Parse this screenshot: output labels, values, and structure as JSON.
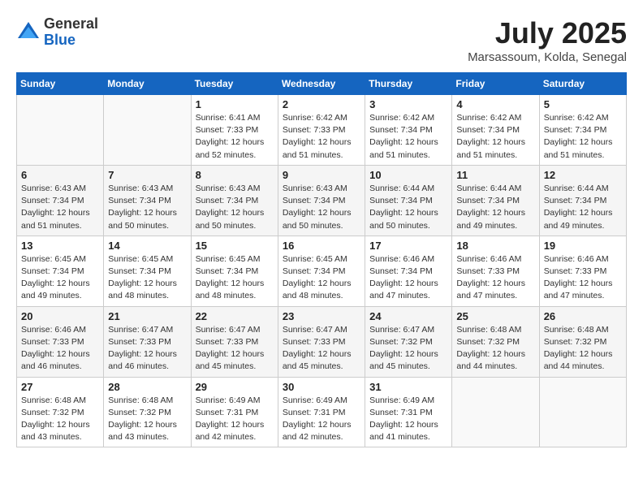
{
  "logo": {
    "general": "General",
    "blue": "Blue"
  },
  "title": {
    "month_year": "July 2025",
    "location": "Marsassoum, Kolda, Senegal"
  },
  "weekdays": [
    "Sunday",
    "Monday",
    "Tuesday",
    "Wednesday",
    "Thursday",
    "Friday",
    "Saturday"
  ],
  "weeks": [
    [
      {
        "num": "",
        "info": ""
      },
      {
        "num": "",
        "info": ""
      },
      {
        "num": "1",
        "info": "Sunrise: 6:41 AM\nSunset: 7:33 PM\nDaylight: 12 hours\nand 52 minutes."
      },
      {
        "num": "2",
        "info": "Sunrise: 6:42 AM\nSunset: 7:33 PM\nDaylight: 12 hours\nand 51 minutes."
      },
      {
        "num": "3",
        "info": "Sunrise: 6:42 AM\nSunset: 7:34 PM\nDaylight: 12 hours\nand 51 minutes."
      },
      {
        "num": "4",
        "info": "Sunrise: 6:42 AM\nSunset: 7:34 PM\nDaylight: 12 hours\nand 51 minutes."
      },
      {
        "num": "5",
        "info": "Sunrise: 6:42 AM\nSunset: 7:34 PM\nDaylight: 12 hours\nand 51 minutes."
      }
    ],
    [
      {
        "num": "6",
        "info": "Sunrise: 6:43 AM\nSunset: 7:34 PM\nDaylight: 12 hours\nand 51 minutes."
      },
      {
        "num": "7",
        "info": "Sunrise: 6:43 AM\nSunset: 7:34 PM\nDaylight: 12 hours\nand 50 minutes."
      },
      {
        "num": "8",
        "info": "Sunrise: 6:43 AM\nSunset: 7:34 PM\nDaylight: 12 hours\nand 50 minutes."
      },
      {
        "num": "9",
        "info": "Sunrise: 6:43 AM\nSunset: 7:34 PM\nDaylight: 12 hours\nand 50 minutes."
      },
      {
        "num": "10",
        "info": "Sunrise: 6:44 AM\nSunset: 7:34 PM\nDaylight: 12 hours\nand 50 minutes."
      },
      {
        "num": "11",
        "info": "Sunrise: 6:44 AM\nSunset: 7:34 PM\nDaylight: 12 hours\nand 49 minutes."
      },
      {
        "num": "12",
        "info": "Sunrise: 6:44 AM\nSunset: 7:34 PM\nDaylight: 12 hours\nand 49 minutes."
      }
    ],
    [
      {
        "num": "13",
        "info": "Sunrise: 6:45 AM\nSunset: 7:34 PM\nDaylight: 12 hours\nand 49 minutes."
      },
      {
        "num": "14",
        "info": "Sunrise: 6:45 AM\nSunset: 7:34 PM\nDaylight: 12 hours\nand 48 minutes."
      },
      {
        "num": "15",
        "info": "Sunrise: 6:45 AM\nSunset: 7:34 PM\nDaylight: 12 hours\nand 48 minutes."
      },
      {
        "num": "16",
        "info": "Sunrise: 6:45 AM\nSunset: 7:34 PM\nDaylight: 12 hours\nand 48 minutes."
      },
      {
        "num": "17",
        "info": "Sunrise: 6:46 AM\nSunset: 7:34 PM\nDaylight: 12 hours\nand 47 minutes."
      },
      {
        "num": "18",
        "info": "Sunrise: 6:46 AM\nSunset: 7:33 PM\nDaylight: 12 hours\nand 47 minutes."
      },
      {
        "num": "19",
        "info": "Sunrise: 6:46 AM\nSunset: 7:33 PM\nDaylight: 12 hours\nand 47 minutes."
      }
    ],
    [
      {
        "num": "20",
        "info": "Sunrise: 6:46 AM\nSunset: 7:33 PM\nDaylight: 12 hours\nand 46 minutes."
      },
      {
        "num": "21",
        "info": "Sunrise: 6:47 AM\nSunset: 7:33 PM\nDaylight: 12 hours\nand 46 minutes."
      },
      {
        "num": "22",
        "info": "Sunrise: 6:47 AM\nSunset: 7:33 PM\nDaylight: 12 hours\nand 45 minutes."
      },
      {
        "num": "23",
        "info": "Sunrise: 6:47 AM\nSunset: 7:33 PM\nDaylight: 12 hours\nand 45 minutes."
      },
      {
        "num": "24",
        "info": "Sunrise: 6:47 AM\nSunset: 7:32 PM\nDaylight: 12 hours\nand 45 minutes."
      },
      {
        "num": "25",
        "info": "Sunrise: 6:48 AM\nSunset: 7:32 PM\nDaylight: 12 hours\nand 44 minutes."
      },
      {
        "num": "26",
        "info": "Sunrise: 6:48 AM\nSunset: 7:32 PM\nDaylight: 12 hours\nand 44 minutes."
      }
    ],
    [
      {
        "num": "27",
        "info": "Sunrise: 6:48 AM\nSunset: 7:32 PM\nDaylight: 12 hours\nand 43 minutes."
      },
      {
        "num": "28",
        "info": "Sunrise: 6:48 AM\nSunset: 7:32 PM\nDaylight: 12 hours\nand 43 minutes."
      },
      {
        "num": "29",
        "info": "Sunrise: 6:49 AM\nSunset: 7:31 PM\nDaylight: 12 hours\nand 42 minutes."
      },
      {
        "num": "30",
        "info": "Sunrise: 6:49 AM\nSunset: 7:31 PM\nDaylight: 12 hours\nand 42 minutes."
      },
      {
        "num": "31",
        "info": "Sunrise: 6:49 AM\nSunset: 7:31 PM\nDaylight: 12 hours\nand 41 minutes."
      },
      {
        "num": "",
        "info": ""
      },
      {
        "num": "",
        "info": ""
      }
    ]
  ]
}
